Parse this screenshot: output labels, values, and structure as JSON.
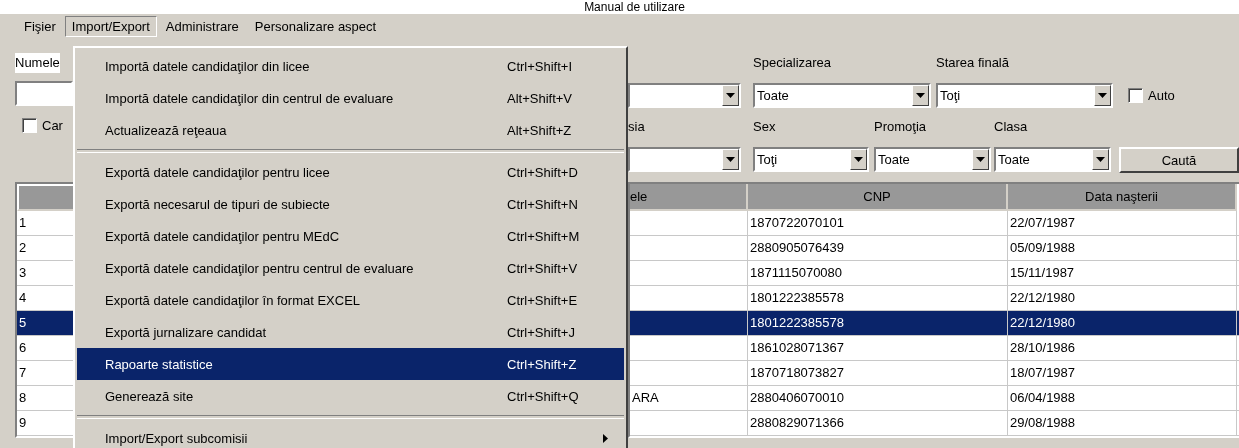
{
  "document_title": "Manual de utilizare",
  "menubar": [
    {
      "label": "Fişier",
      "selected": false
    },
    {
      "label": "Import/Export",
      "selected": true
    },
    {
      "label": "Administrare",
      "selected": false
    },
    {
      "label": "Personalizare aspect",
      "selected": false
    }
  ],
  "menu": {
    "items": [
      {
        "kind": "item",
        "label": "Importă datele candidaţilor din licee",
        "shortcut": "Ctrl+Shift+I",
        "selected": false
      },
      {
        "kind": "item",
        "label": "Importă datele candidaţilor din centrul de evaluare",
        "shortcut": "Alt+Shift+V",
        "selected": false
      },
      {
        "kind": "item",
        "label": "Actualizează reţeaua",
        "shortcut": "Alt+Shift+Z",
        "selected": false
      },
      {
        "kind": "separator"
      },
      {
        "kind": "item",
        "label": "Exportă datele candidaţilor pentru licee",
        "shortcut": "Ctrl+Shift+D",
        "selected": false
      },
      {
        "kind": "item",
        "label": "Exportă necesarul de tipuri de subiecte",
        "shortcut": "Ctrl+Shift+N",
        "selected": false
      },
      {
        "kind": "item",
        "label": "Exportă datele candidaţilor pentru MEdC",
        "shortcut": "Ctrl+Shift+M",
        "selected": false
      },
      {
        "kind": "item",
        "label": "Exportă datele candidaţilor pentru centrul de evaluare",
        "shortcut": "Ctrl+Shift+V",
        "selected": false
      },
      {
        "kind": "item",
        "label": "Exportă datele candidaţilor în format EXCEL",
        "shortcut": "Ctrl+Shift+E",
        "selected": false
      },
      {
        "kind": "item",
        "label": "Exportă jurnalizare candidat",
        "shortcut": "Ctrl+Shift+J",
        "selected": false
      },
      {
        "kind": "item",
        "label": "Rapoarte statistice",
        "shortcut": "Ctrl+Shift+Z",
        "selected": true
      },
      {
        "kind": "item",
        "label": "Generează site",
        "shortcut": "Ctrl+Shift+Q",
        "selected": false
      },
      {
        "kind": "separator"
      },
      {
        "kind": "submenu",
        "label": "Import/Export subcomisii",
        "selected": false
      }
    ]
  },
  "left_filters": {
    "label": "Numele",
    "checkbox": {
      "label": "Car",
      "checked": false
    }
  },
  "right_filters": {
    "row_1": [
      {
        "kind": "combo"
      },
      {
        "kind": "combo",
        "label": "Specializarea",
        "value": "Toate"
      },
      {
        "kind": "combo",
        "label": "Starea finală",
        "value": "Toţi"
      }
    ],
    "auto_checkbox": {
      "label": "Auto",
      "checked": false
    },
    "row_2": [
      {
        "kind": "combo",
        "label": "sia"
      },
      {
        "kind": "combo",
        "label": "Sex",
        "value": "Toţi"
      },
      {
        "kind": "combo",
        "label": "Promoţia",
        "value": "Toate"
      },
      {
        "kind": "combo",
        "label": "Clasa",
        "value": "Toate"
      }
    ],
    "search_button": "Caută"
  },
  "table": {
    "columns": [
      "ele",
      "CNP",
      "Data naşterii"
    ],
    "rows": [
      {
        "number": "1",
        "cnp": "1870722070101",
        "birth_date": "22/07/1987",
        "selected": false
      },
      {
        "number": "2",
        "cnp": "2880905076439",
        "birth_date": "05/09/1988",
        "selected": false
      },
      {
        "number": "3",
        "cnp": "1871115070080",
        "birth_date": "15/11/1987",
        "selected": false
      },
      {
        "number": "4",
        "cnp": "1801222385578",
        "birth_date": "22/12/1980",
        "selected": false
      },
      {
        "number": "5",
        "cnp": "1801222385578",
        "birth_date": "22/12/1980",
        "selected": true
      },
      {
        "number": "6",
        "cnp": "1861028071367",
        "birth_date": "28/10/1986",
        "selected": false
      },
      {
        "number": "7",
        "cnp": "1870718073827",
        "birth_date": "18/07/1987",
        "selected": false
      },
      {
        "number": "8",
        "column_2": "ARA",
        "cnp": "2880406070010",
        "birth_date": "06/04/1988",
        "selected": false
      },
      {
        "number": "9",
        "cnp": "2880829071366",
        "birth_date": "29/08/1988",
        "selected": false
      }
    ]
  }
}
